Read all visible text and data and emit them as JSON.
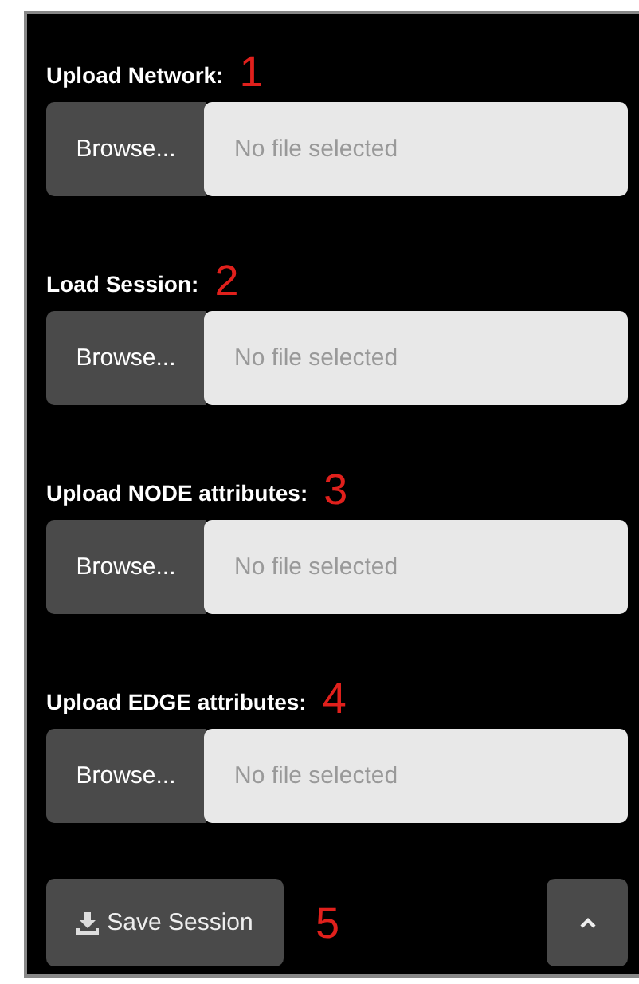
{
  "uploads": [
    {
      "label": "Upload Network:",
      "annotation": "1",
      "button": "Browse...",
      "placeholder": "No file selected"
    },
    {
      "label": "Load Session:",
      "annotation": "2",
      "button": "Browse...",
      "placeholder": "No file selected"
    },
    {
      "label": "Upload NODE attributes:",
      "annotation": "3",
      "button": "Browse...",
      "placeholder": "No file selected"
    },
    {
      "label": "Upload EDGE attributes:",
      "annotation": "4",
      "button": "Browse...",
      "placeholder": "No file selected"
    }
  ],
  "save_button": {
    "label": "Save Session",
    "annotation": "5"
  }
}
